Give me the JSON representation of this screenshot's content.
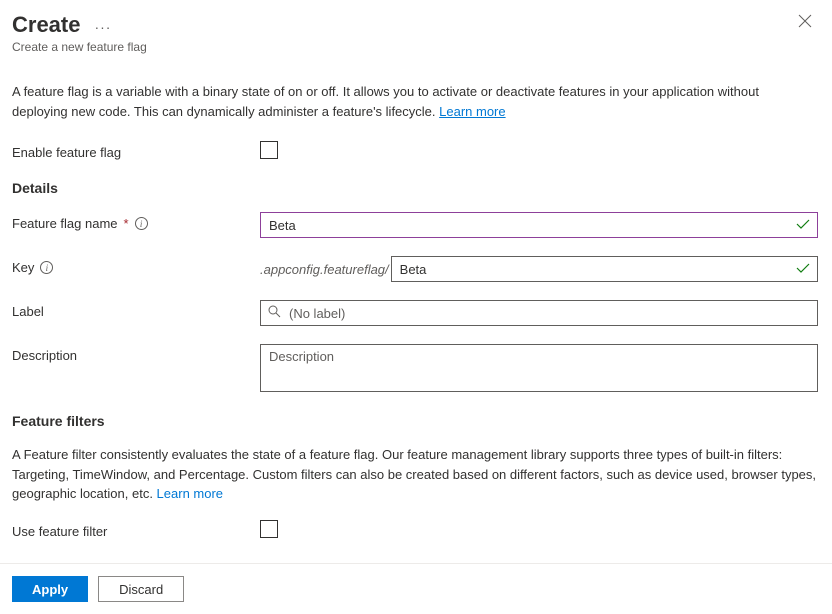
{
  "header": {
    "title": "Create",
    "subtitle": "Create a new feature flag"
  },
  "intro": {
    "text": "A feature flag is a variable with a binary state of on or off. It allows you to activate or deactivate features in your application without deploying new code. This can dynamically administer a feature's lifecycle. ",
    "link_label": "Learn more"
  },
  "form": {
    "enable_label": "Enable feature flag",
    "details_heading": "Details",
    "name_label": "Feature flag name",
    "name_value": "Beta",
    "key_label": "Key",
    "key_prefix": ".appconfig.featureflag/",
    "key_value": "Beta",
    "label_label": "Label",
    "label_placeholder": "(No label)",
    "description_label": "Description",
    "description_placeholder": "Description"
  },
  "filters": {
    "heading": "Feature filters",
    "text": "A Feature filter consistently evaluates the state of a feature flag. Our feature management library supports three types of built-in filters: Targeting, TimeWindow, and Percentage. Custom filters can also be created based on different factors, such as device used, browser types, geographic location, etc. ",
    "link_label": "Learn more",
    "use_filter_label": "Use feature filter"
  },
  "footer": {
    "apply_label": "Apply",
    "discard_label": "Discard"
  }
}
